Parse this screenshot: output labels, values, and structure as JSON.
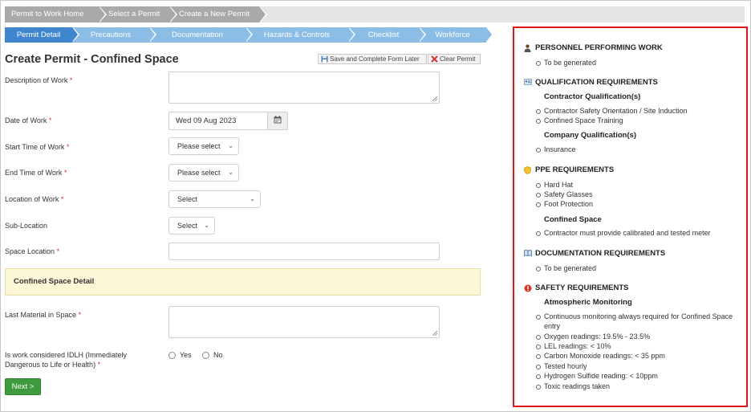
{
  "breadcrumb": [
    "Permit to Work Home",
    "Select a Permit",
    "Create a New Permit"
  ],
  "steps": [
    "Permit Detail",
    "Precautions",
    "Documentation",
    "Hazards & Controls",
    "Checklist",
    "Workforce"
  ],
  "page_title": "Create Permit - Confined Space",
  "toolbar": {
    "save_label": "Save and Complete Form Later",
    "clear_label": "Clear Permit"
  },
  "form": {
    "description_label": "Description of Work",
    "date_label": "Date of Work",
    "date_value": "Wed 09 Aug 2023",
    "start_label": "Start Time of Work",
    "start_value": "Please select",
    "end_label": "End Time of Work",
    "end_value": "Please select",
    "location_label": "Location of Work",
    "location_value": "Select",
    "sublocation_label": "Sub-Location",
    "sublocation_value": "Select",
    "space_location_label": "Space Location",
    "required_mark": "*",
    "detail_heading": "Confined Space Detail",
    "last_material_label": "Last Material in Space",
    "idlh_label_line1": "Is work considered IDLH (Immediately",
    "idlh_label_line2": "Dangerous to Life or Health)",
    "yes_label": "Yes",
    "no_label": "No",
    "next_label": "Next >"
  },
  "panel": {
    "personnel": {
      "title": "PERSONNEL PERFORMING WORK",
      "items": [
        "To be generated"
      ]
    },
    "qualification": {
      "title": "QUALIFICATION REQUIREMENTS",
      "contractor_title": "Contractor Qualification(s)",
      "contractor_items": [
        "Contractor Safety Orientation / Site Induction",
        "Confined Space Training"
      ],
      "company_title": "Company Qualification(s)",
      "company_items": [
        "Insurance"
      ]
    },
    "ppe": {
      "title": "PPE REQUIREMENTS",
      "items": [
        "Hard Hat",
        "Safety Glasses",
        "Foot Protection"
      ],
      "confined_title": "Confined Space",
      "confined_items": [
        "Contractor must provide calibrated and tested meter"
      ]
    },
    "documentation": {
      "title": "DOCUMENTATION REQUIREMENTS",
      "items": [
        "To be generated"
      ]
    },
    "safety": {
      "title": "SAFETY REQUIREMENTS",
      "atmo_title": "Atmospheric Monitoring",
      "items": [
        "Continuous monitoring always required for Confined Space entry",
        "Oxygen readings: 19.5% - 23.5%",
        "LEL readings: < 10%",
        "Carbon Monoxide readings: < 35 ppm",
        "Tested hourly",
        "Hydrogen Sulfide reading: < 10ppm",
        "Toxic readings taken"
      ]
    }
  },
  "colors": {
    "accent": "#3f86cf",
    "step_inactive": "#8bbde6",
    "required": "#d9342b",
    "panel_border": "#e0161c",
    "next_button": "#3e9b3e"
  }
}
